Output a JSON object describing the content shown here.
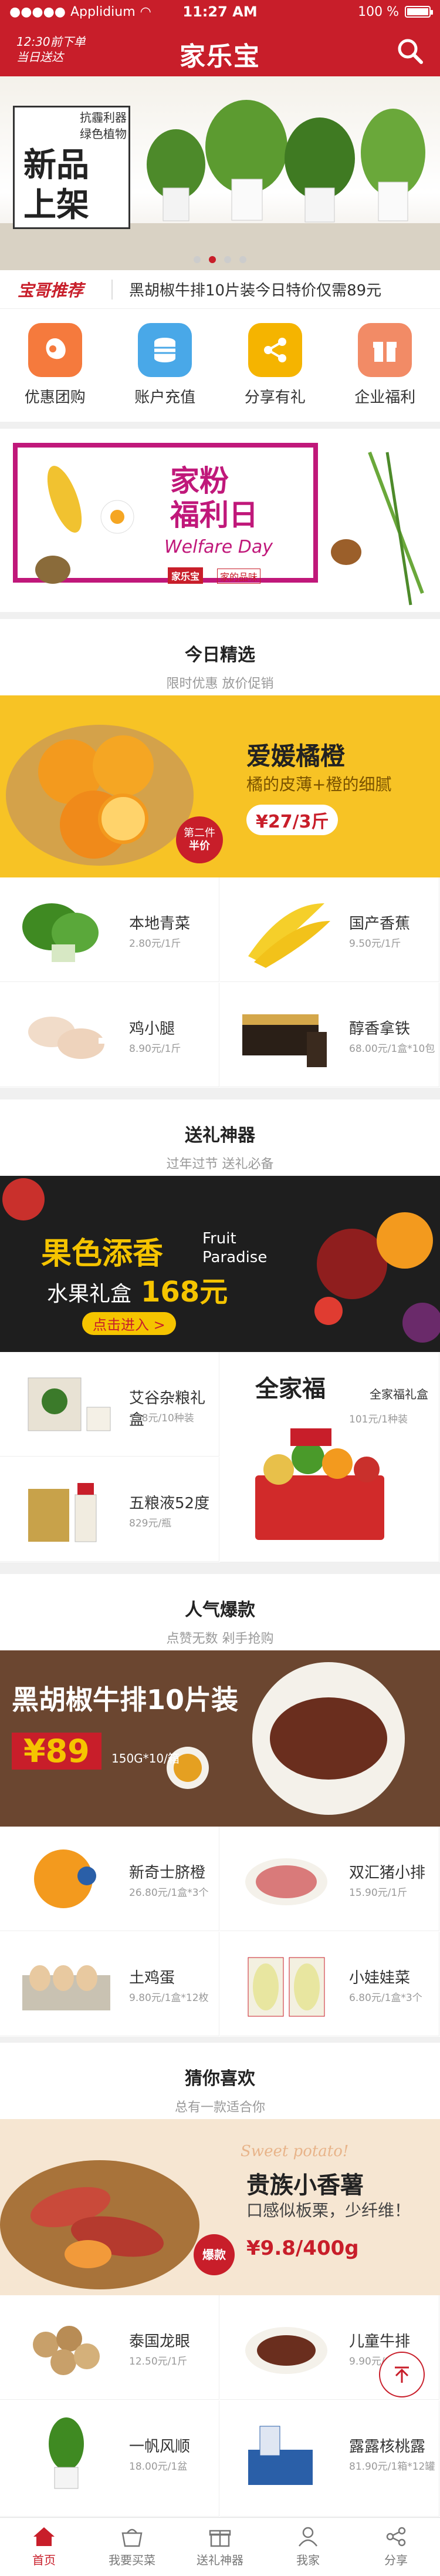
{
  "status_bar": {
    "carrier": "Applidium",
    "time": "11:27 AM",
    "battery": "100 %"
  },
  "header": {
    "hint_line1": "12:30前下单",
    "hint_line2": "当日送达",
    "logo": "家乐宝",
    "search_icon": "search-icon"
  },
  "banner": {
    "tag_small": "抗霾利器 绿色植物",
    "tag_big": "新品上架",
    "slides": 4,
    "active_slide": 1
  },
  "ticker": {
    "badge": "宝哥推荐",
    "text": "黑胡椒牛排10片装今日特价仅需89元"
  },
  "quick_menu": [
    {
      "label": "优惠团购",
      "icon": "group-buy-icon",
      "color": "#f57a3d"
    },
    {
      "label": "账户充值",
      "icon": "wallet-icon",
      "color": "#49a8e8"
    },
    {
      "label": "分享有礼",
      "icon": "share-icon",
      "color": "#f5b400"
    },
    {
      "label": "企业福利",
      "icon": "gift-icon",
      "color": "#f28b66"
    }
  ],
  "welfare": {
    "title_line1": "家粉",
    "title_line2": "福利日",
    "subtitle": "Welfare Day",
    "brand": "家乐宝",
    "slogan": "家的品味"
  },
  "sections": {
    "daily": {
      "title": "今日精选",
      "subtitle": "限时优惠 放价促销",
      "promo": {
        "headline": "爱媛橘橙",
        "desc": "橘的皮薄+橙的细腻",
        "price": "¥27/3斤",
        "badge1": "第二件",
        "badge2": "半价"
      },
      "items": [
        {
          "name": "本地青菜",
          "price": "2.80元/1斤"
        },
        {
          "name": "国产香蕉",
          "price": "9.50元/1斤"
        },
        {
          "name": "鸡小腿",
          "price": "8.90元/1斤"
        },
        {
          "name": "醇香拿铁",
          "price": "68.00元/1盒*10包"
        }
      ]
    },
    "gift": {
      "title": "送礼神器",
      "subtitle": "过年过节 送礼必备",
      "promo": {
        "headline": "果色添香",
        "en1": "Fruit",
        "en2": "Paradise",
        "sub": "水果礼盒",
        "price": "168元",
        "cta": "点击进入 >"
      },
      "items": [
        {
          "name": "艾谷杂粮礼盒",
          "price": "128元/10种装"
        },
        {
          "name": "五粮液52度",
          "price": "829元/瓶"
        },
        {
          "name": "全家福礼盒",
          "price": "101元/1种装"
        }
      ],
      "big_brand": "全家福"
    },
    "hot": {
      "title": "人气爆款",
      "subtitle": "点赞无数 剁手抢购",
      "promo": {
        "headline": "黑胡椒牛排10片装",
        "price": "¥89",
        "spec": "150G*10/箱"
      },
      "items": [
        {
          "name": "新奇士脐橙",
          "price": "26.80元/1盒*3个"
        },
        {
          "name": "双汇猪小排",
          "price": "15.90元/1斤"
        },
        {
          "name": "土鸡蛋",
          "price": "9.80元/1盒*12枚"
        },
        {
          "name": "小娃娃菜",
          "price": "6.80元/1盒*3个"
        }
      ]
    },
    "like": {
      "title": "猜你喜欢",
      "subtitle": "总有一款适合你",
      "promo": {
        "script": "Sweet potato!",
        "headline": "贵族小香薯",
        "desc": "口感似板栗，少纤维！",
        "badge": "爆款",
        "price": "¥9.8/400g"
      },
      "items": [
        {
          "name": "泰国龙眼",
          "price": "12.50元/1斤"
        },
        {
          "name": "儿童牛排",
          "price": "9.90元/1片"
        },
        {
          "name": "一帆风顺",
          "price": "18.00元/1盆"
        },
        {
          "name": "露露核桃露",
          "price": "81.90元/1箱*12罐"
        }
      ]
    }
  },
  "tabbar": [
    {
      "label": "首页",
      "icon": "home-icon",
      "active": true
    },
    {
      "label": "我要买菜",
      "icon": "basket-icon",
      "active": false
    },
    {
      "label": "送礼神器",
      "icon": "gift-icon",
      "active": false
    },
    {
      "label": "我家",
      "icon": "user-icon",
      "active": false
    },
    {
      "label": "分享",
      "icon": "share-icon",
      "active": false
    }
  ],
  "colors": {
    "brand": "#c81e2a",
    "welfare": "#c0187a"
  }
}
